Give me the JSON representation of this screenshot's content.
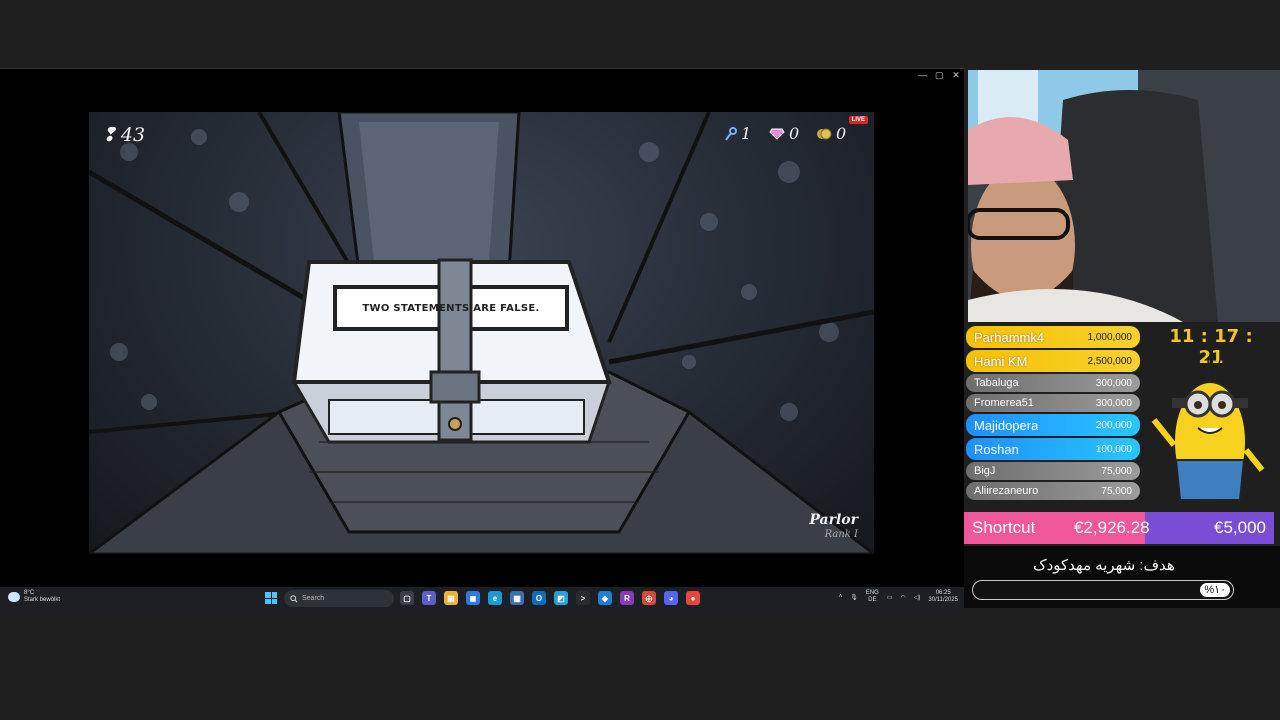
{
  "game": {
    "steps": "43",
    "keys": "1",
    "gems": "0",
    "coins": "0",
    "live": "LIVE",
    "box_text": "TWO STATEMENTS ARE FALSE.",
    "room_name": "Parlor",
    "room_rank": "Rank I"
  },
  "taskbar": {
    "weather_temp": "8°C",
    "weather_desc": "Stark bewölkt",
    "search_placeholder": "Search",
    "lang_top": "ENG",
    "lang_bottom": "DE",
    "time": "06:25",
    "date": "30/11/2025",
    "apps": [
      {
        "icon": "task-view-icon",
        "color": "#3a3f47",
        "glyph": "▢"
      },
      {
        "icon": "teams-icon",
        "color": "#5b5fc7",
        "glyph": "T"
      },
      {
        "icon": "file-explorer-icon",
        "color": "#e8b33a",
        "glyph": "▤"
      },
      {
        "icon": "store-icon",
        "color": "#2e7be0",
        "glyph": "◼"
      },
      {
        "icon": "edge-icon",
        "color": "#1a9bd7",
        "glyph": "e"
      },
      {
        "icon": "app-icon",
        "color": "#3d6fb0",
        "glyph": "▦"
      },
      {
        "icon": "outlook-icon",
        "color": "#0f6cbd",
        "glyph": "O"
      },
      {
        "icon": "app-icon",
        "color": "#2aa0d8",
        "glyph": "◩"
      },
      {
        "icon": "terminal-icon",
        "color": "#2b2b2b",
        "glyph": ">"
      },
      {
        "icon": "vscode-icon",
        "color": "#1e7fd6",
        "glyph": "◆"
      },
      {
        "icon": "rider-icon",
        "color": "#8a3ab9",
        "glyph": "R"
      },
      {
        "icon": "app-icon",
        "color": "#d44a3a",
        "glyph": "◎"
      },
      {
        "icon": "discord-icon",
        "color": "#5865f2",
        "glyph": "◕"
      },
      {
        "icon": "chrome-icon",
        "color": "#e8453c",
        "glyph": "●"
      }
    ]
  },
  "leaderboard": [
    {
      "name": "Parhammk4",
      "amount": "1,000,000",
      "tier": "gold",
      "size": "big"
    },
    {
      "name": "Hami KM",
      "amount": "2,500,000",
      "tier": "gold",
      "size": "big"
    },
    {
      "name": "Tabaluga",
      "amount": "300,000",
      "tier": "gray",
      "size": "small"
    },
    {
      "name": "Fromerea51",
      "amount": "300,000",
      "tier": "gray",
      "size": "small"
    },
    {
      "name": "Majidopera",
      "amount": "200,000",
      "tier": "blue",
      "size": "big"
    },
    {
      "name": "Roshan",
      "amount": "100,000",
      "tier": "blue",
      "size": "big"
    },
    {
      "name": "BigJ",
      "amount": "75,000",
      "tier": "gray",
      "size": "small"
    },
    {
      "name": "Aliirezaneuro",
      "amount": "75,000",
      "tier": "gray",
      "size": "small"
    }
  ],
  "clock": "11 : 17 : 21",
  "goal": {
    "name": "Shortcut",
    "current": "€2,926.28",
    "target": "€5,000",
    "progress": 0.585
  },
  "sub_goal": {
    "label": "هدف: شهریه مهدکودک",
    "percent_text": "%۱۰",
    "progress": 0.1
  }
}
